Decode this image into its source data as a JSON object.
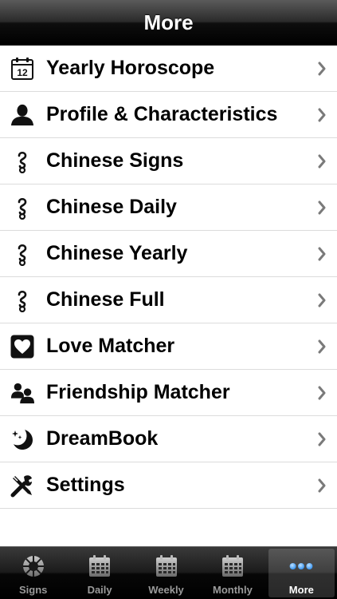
{
  "navbar": {
    "title": "More"
  },
  "menu": [
    {
      "label": "Yearly Horoscope",
      "icon": "calendar-12-icon"
    },
    {
      "label": "Profile & Characteristics",
      "icon": "person-icon"
    },
    {
      "label": "Chinese Signs",
      "icon": "chinese-symbol-icon"
    },
    {
      "label": "Chinese Daily",
      "icon": "chinese-symbol-icon"
    },
    {
      "label": "Chinese Yearly",
      "icon": "chinese-symbol-icon"
    },
    {
      "label": "Chinese Full",
      "icon": "chinese-symbol-icon"
    },
    {
      "label": "Love Matcher",
      "icon": "heart-icon"
    },
    {
      "label": "Friendship Matcher",
      "icon": "two-people-icon"
    },
    {
      "label": "DreamBook",
      "icon": "moon-stars-icon"
    },
    {
      "label": "Settings",
      "icon": "tools-icon"
    }
  ],
  "calendar_icon_number": "12",
  "tabs": [
    {
      "label": "Signs",
      "icon": "zodiac-wheel-icon",
      "selected": false
    },
    {
      "label": "Daily",
      "icon": "calendar-icon",
      "selected": false
    },
    {
      "label": "Weekly",
      "icon": "calendar-icon",
      "selected": false
    },
    {
      "label": "Monthly",
      "icon": "calendar-icon",
      "selected": false
    },
    {
      "label": "More",
      "icon": "more-dots-icon",
      "selected": true
    }
  ],
  "colors": {
    "navbar": "#000000",
    "tab_selected_icon": "#4aa3ff",
    "tab_label": "#9a9a9a",
    "chevron": "#7a7a7a",
    "separator": "#dcdcdc"
  }
}
